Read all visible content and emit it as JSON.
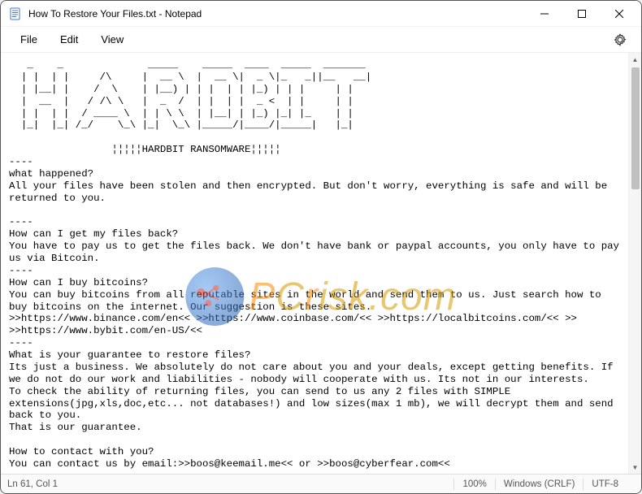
{
  "window": {
    "title": "How To Restore Your Files.txt - Notepad"
  },
  "menu": {
    "file": "File",
    "edit": "Edit",
    "view": "View"
  },
  "content": "   _    _              _____    _____  ____  _____  _______\n  | |  | |     /\\     |  __ \\  |  __ \\|  _ \\|_   _||__   __|\n  | |__| |    /  \\    | |__) | | |  | | |_) | | |     | |\n  |  __  |   / /\\ \\   |  _  /  | |  | |  _ <  | |     | |\n  | |  | |  / ____ \\  | | \\ \\  | |__| | |_) |_| |_    | |\n  |_|  |_| /_/    \\_\\ |_|  \\_\\ |_____/|____/|_____|   |_|\n\n                 ¦¦¦¦¦HARDBIT RANSOMWARE¦¦¦¦¦\n----\nwhat happened?\nAll your files have been stolen and then encrypted. But don't worry, everything is safe and will be returned to you.\n\n----\nHow can I get my files back?\nYou have to pay us to get the files back. We don't have bank or paypal accounts, you only have to pay us via Bitcoin.\n----\nHow can I buy bitcoins?\nYou can buy bitcoins from all reputable sites in the world and send them to us. Just search how to buy bitcoins on the internet. Our suggestion is these sites.\n>>https://www.binance.com/en<< >>https://www.coinbase.com/<< >>https://localbitcoins.com/<< >>\n>>https://www.bybit.com/en-US/<<\n----\nWhat is your guarantee to restore files?\nIts just a business. We absolutely do not care about you and your deals, except getting benefits. If we do not do our work and liabilities - nobody will cooperate with us. Its not in our interests.\nTo check the ability of returning files, you can send to us any 2 files with SIMPLE extensions(jpg,xls,doc,etc... not databases!) and low sizes(max 1 mb), we will decrypt them and send back to you.\nThat is our guarantee.\n\nHow to contact with you?\nYou can contact us by email:>>boos@keemail.me<< or >>boos@cyberfear.com<<",
  "status": {
    "pos": "Ln 61, Col 1",
    "zoom": "100%",
    "eol": "Windows (CRLF)",
    "encoding": "UTF-8"
  },
  "watermark": {
    "text": "PCrisk.com"
  }
}
